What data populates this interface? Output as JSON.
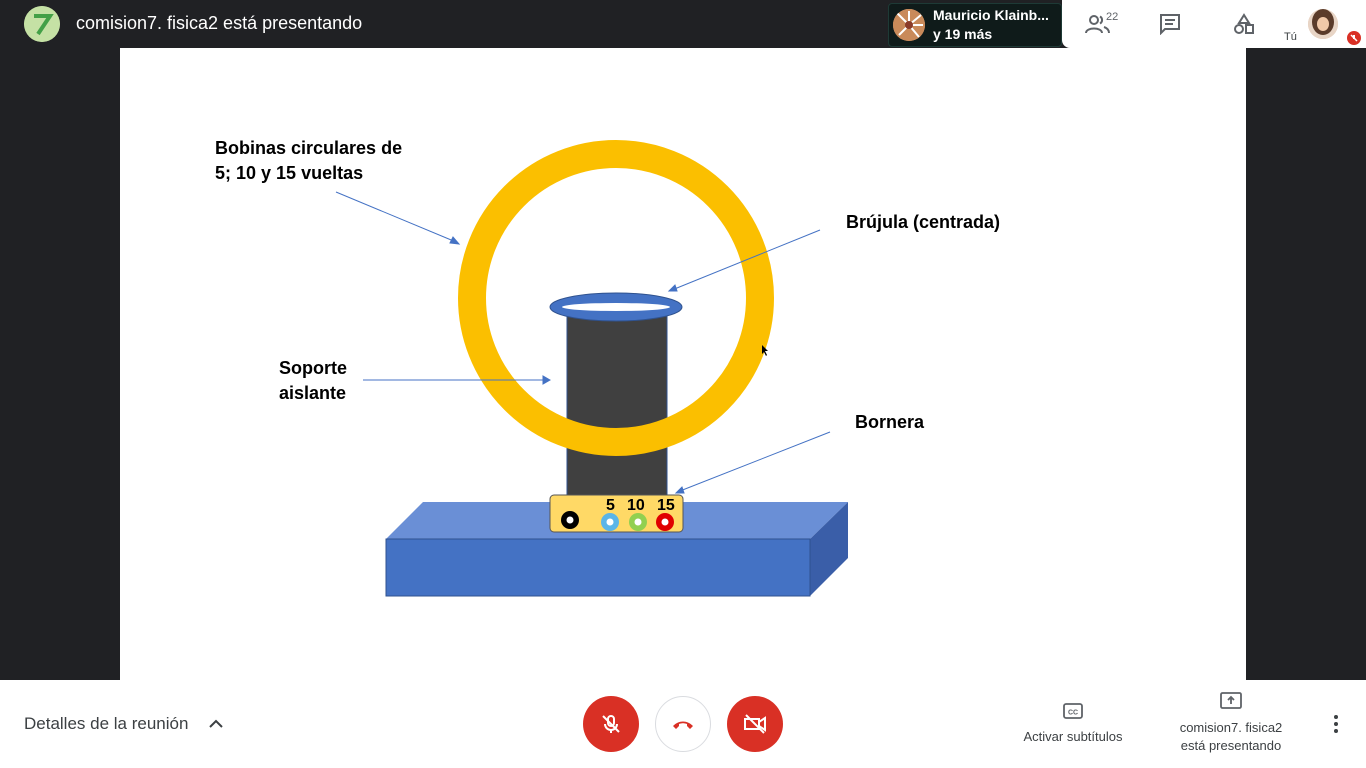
{
  "topbar": {
    "presenter_title": "comision7. fisica2 está presentando",
    "participant_name": "Mauricio Klainb...",
    "participant_more": "y 19 más",
    "people_count": "22",
    "self_label": "Tú"
  },
  "slide": {
    "label_coils_line1": "Bobinas circulares de",
    "label_coils_line2": "5; 10 y 15 vueltas",
    "label_compass": "Brújula (centrada)",
    "label_support_line1": "Soporte",
    "label_support_line2": "aislante",
    "label_terminal": "Bornera",
    "terminal_numbers": [
      "5",
      "10",
      "15"
    ]
  },
  "bottombar": {
    "meeting_details": "Detalles de la reunión",
    "captions_label": "Activar subtítulos",
    "presenting_line1": "comision7. fisica2",
    "presenting_line2": "está presentando"
  },
  "colors": {
    "ring": "#fbbf00",
    "support": "#404040",
    "base": "#4472c4",
    "compass": "#4472c4",
    "red_button": "#d93025"
  },
  "icons": [
    "group-icon",
    "chat-icon",
    "activities-icon",
    "mic-off-icon",
    "hangup-icon",
    "camera-off-icon",
    "captions-icon",
    "present-icon",
    "more-vert-icon",
    "chevron-up-icon"
  ]
}
